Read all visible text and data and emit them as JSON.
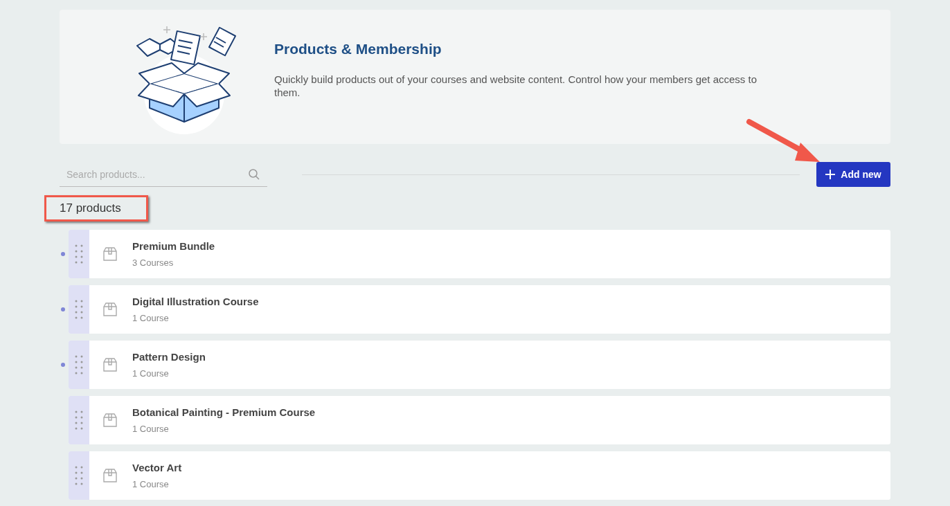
{
  "header": {
    "title": "Products & Membership",
    "description": "Quickly build products out of your courses and website content. Control how your members get access to them."
  },
  "search": {
    "placeholder": "Search products..."
  },
  "add_button": {
    "label": "Add new"
  },
  "count": "17 products",
  "products": [
    {
      "name": "Premium Bundle",
      "meta": "3 Courses",
      "marked": true
    },
    {
      "name": "Digital Illustration Course",
      "meta": "1 Course",
      "marked": true
    },
    {
      "name": "Pattern Design",
      "meta": "1 Course",
      "marked": true
    },
    {
      "name": "Botanical Painting - Premium Course",
      "meta": "1 Course",
      "marked": false
    },
    {
      "name": "Vector Art",
      "meta": "1 Course",
      "marked": false
    }
  ]
}
